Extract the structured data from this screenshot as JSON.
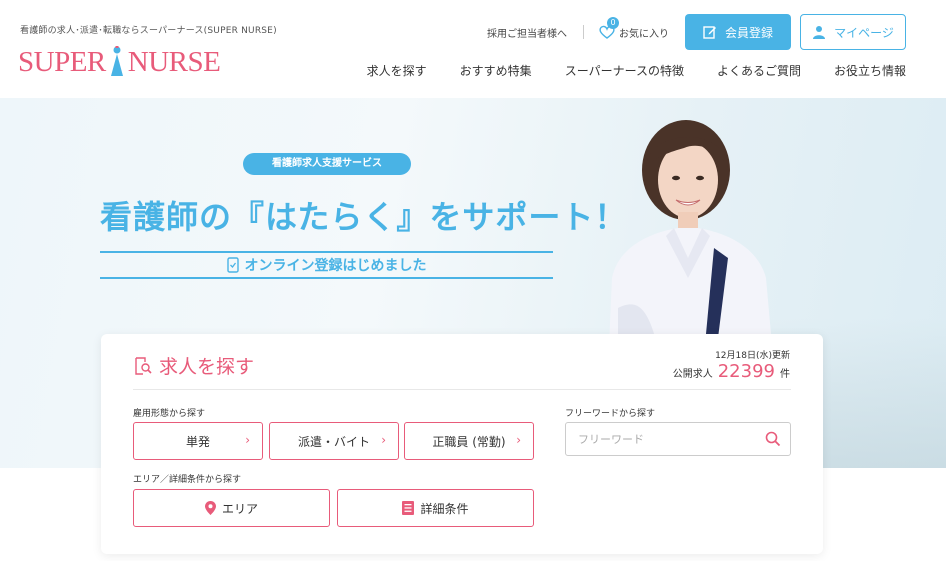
{
  "header": {
    "tagline": "看護師の求人･派遣･転職ならスーパーナース(SUPER NURSE)",
    "logo_left": "SUPER",
    "logo_right": "NURSE",
    "recruiter_link": "採用ご担当者様へ",
    "favorites_label": "お気に入り",
    "favorites_count": "0",
    "register_button": "会員登録",
    "mypage_button": "マイページ",
    "nav": [
      "求人を探す",
      "おすすめ特集",
      "スーパーナースの特徴",
      "よくあるご質問",
      "お役立ち情報"
    ]
  },
  "hero": {
    "pill": "看護師求人支援サービス",
    "title": "看護師の『はたらく』をサポート！",
    "subtitle": "オンライン登録はじめました"
  },
  "search_panel": {
    "title": "求人を探す",
    "update_date": "12月18日(水)更新",
    "count_prefix": "公開求人",
    "count": "22399",
    "count_suffix": "件",
    "employment_label": "雇用形態から探す",
    "employment_options": [
      "単発",
      "派遣・バイト",
      "正職員 (常勤)"
    ],
    "freeword_label": "フリーワードから探す",
    "freeword_placeholder": "フリーワード",
    "area_label": "エリア／詳細条件から探す",
    "area_button": "エリア",
    "detail_button": "詳細条件"
  },
  "colors": {
    "brand_pink": "#e85b7a",
    "brand_blue": "#49b3e5"
  }
}
